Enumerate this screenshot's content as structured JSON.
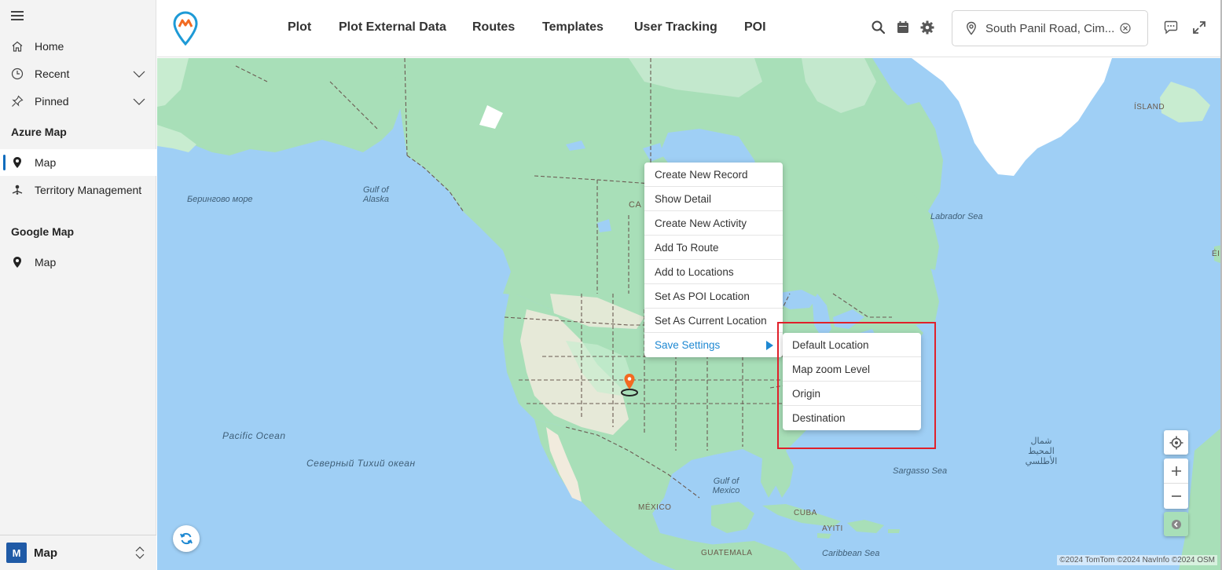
{
  "sidebar": {
    "items": [
      {
        "label": "Home",
        "icon": "home-icon"
      },
      {
        "label": "Recent",
        "icon": "clock-icon"
      },
      {
        "label": "Pinned",
        "icon": "pin-icon"
      }
    ],
    "sections": [
      {
        "title": "Azure Map",
        "items": [
          {
            "label": "Map",
            "icon": "map-marker-icon",
            "selected": true
          },
          {
            "label": "Territory Management",
            "icon": "territory-icon",
            "selected": false
          }
        ]
      },
      {
        "title": "Google Map",
        "items": [
          {
            "label": "Map",
            "icon": "map-marker-icon",
            "selected": false
          }
        ]
      }
    ],
    "area": {
      "badge": "M",
      "label": "Map"
    }
  },
  "header": {
    "nav": [
      "Plot",
      "Plot External Data",
      "Routes",
      "Templates",
      "User Tracking",
      "POI"
    ],
    "location_search": {
      "value": "South Panil Road, Cim..."
    }
  },
  "map": {
    "labels": {
      "bering": "Берингово море",
      "gulf_alaska": "Gulf of\nAlaska",
      "canada_partial": "CA",
      "labrador": "Labrador Sea",
      "iceland": "ÍSLAND",
      "pacific": "Pacific Ocean",
      "north_pacific_ru": "Северный Тихий океан",
      "gulf_mexico": "Gulf of\nMexico",
      "mexico": "MÉXICO",
      "sargasso": "Sargasso Sea",
      "atlantic_ar": "شمال المحيط\nالأطلسي",
      "cuba": "CUBA",
      "haiti": "AYITI",
      "caribbean": "Caribbean Sea",
      "guatemala": "GUATEMALA",
      "eire": "ÉIR"
    },
    "copyright": "©2024 TomTom ©2024 NavInfo ©2024 OSM"
  },
  "context_menu": {
    "items": [
      "Create New Record",
      "Show Detail",
      "Create New Activity",
      "Add To Route",
      "Add to Locations",
      "Set As POI Location",
      "Set As Current Location",
      "Save Settings"
    ],
    "active_index": 7,
    "submenu": [
      "Default Location",
      "Map zoom Level",
      "Origin",
      "Destination"
    ]
  },
  "colors": {
    "ocean": "#9fcff5",
    "land": "#a8dfb8",
    "land_light": "#c8ecd0",
    "desert": "#f1ebdd",
    "accent": "#1e88d2",
    "highlight": "#e0202a",
    "marker": "#f26a21"
  }
}
